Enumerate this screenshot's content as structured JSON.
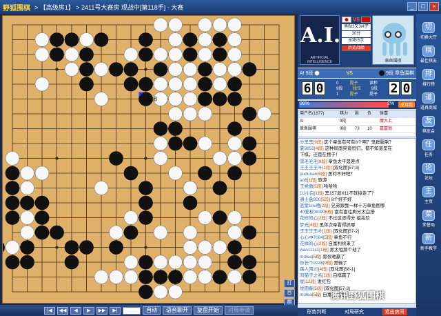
{
  "titlebar": {
    "logo": "野狐围棋",
    "breadcrumb": "> 【高级房1】 > 2411号大赛房 观战中[第118手] - 大赛",
    "buttons": [
      "_",
      "□",
      "×"
    ]
  },
  "board": {
    "size": 19,
    "last_move_label": "118",
    "last_move": {
      "col": 10,
      "row": 6
    },
    "black": [
      [
        4,
        2
      ],
      [
        5,
        2
      ],
      [
        7,
        2
      ],
      [
        10,
        2
      ],
      [
        13,
        2
      ],
      [
        15,
        2
      ],
      [
        4,
        3
      ],
      [
        6,
        3
      ],
      [
        10,
        3
      ],
      [
        13,
        3
      ],
      [
        15,
        3
      ],
      [
        6,
        4
      ],
      [
        8,
        4
      ],
      [
        9,
        4
      ],
      [
        11,
        4
      ],
      [
        14,
        4
      ],
      [
        17,
        4
      ],
      [
        6,
        5
      ],
      [
        9,
        5
      ],
      [
        10,
        5
      ],
      [
        14,
        5
      ],
      [
        16,
        5
      ],
      [
        10,
        6
      ],
      [
        14,
        6
      ],
      [
        15,
        6
      ],
      [
        16,
        6
      ],
      [
        17,
        7
      ],
      [
        11,
        8
      ],
      [
        12,
        8
      ],
      [
        16,
        8
      ],
      [
        12,
        9
      ],
      [
        13,
        9
      ],
      [
        17,
        9
      ],
      [
        8,
        10
      ],
      [
        17,
        10
      ],
      [
        1,
        11
      ],
      [
        9,
        11
      ],
      [
        14,
        11
      ],
      [
        16,
        11
      ],
      [
        1,
        12
      ],
      [
        10,
        12
      ],
      [
        13,
        12
      ],
      [
        15,
        12
      ],
      [
        1,
        13
      ],
      [
        2,
        13
      ],
      [
        3,
        13
      ],
      [
        10,
        13
      ],
      [
        13,
        13
      ],
      [
        1,
        14
      ],
      [
        3,
        14
      ],
      [
        10,
        14
      ],
      [
        15,
        14
      ],
      [
        3,
        15
      ],
      [
        4,
        15
      ],
      [
        9,
        15
      ],
      [
        17,
        15
      ],
      [
        0,
        16
      ],
      [
        2,
        16
      ],
      [
        5,
        16
      ],
      [
        6,
        16
      ],
      [
        8,
        16
      ],
      [
        16,
        16
      ],
      [
        1,
        17
      ],
      [
        2,
        17
      ],
      [
        5,
        17
      ],
      [
        10,
        17
      ],
      [
        16,
        17
      ],
      [
        17,
        17
      ],
      [
        10,
        18
      ],
      [
        11,
        18
      ],
      [
        12,
        18
      ],
      [
        15,
        18
      ],
      [
        17,
        18
      ],
      [
        10,
        19
      ]
    ],
    "white": [
      [
        11,
        1
      ],
      [
        12,
        1
      ],
      [
        14,
        1
      ],
      [
        15,
        1
      ],
      [
        16,
        1
      ],
      [
        3,
        2
      ],
      [
        6,
        2
      ],
      [
        12,
        2
      ],
      [
        14,
        2
      ],
      [
        16,
        2
      ],
      [
        3,
        3
      ],
      [
        5,
        3
      ],
      [
        9,
        3
      ],
      [
        11,
        3
      ],
      [
        12,
        3
      ],
      [
        14,
        3
      ],
      [
        16,
        3
      ],
      [
        5,
        4
      ],
      [
        7,
        4
      ],
      [
        12,
        4
      ],
      [
        13,
        4
      ],
      [
        15,
        4
      ],
      [
        16,
        4
      ],
      [
        3,
        5
      ],
      [
        11,
        5
      ],
      [
        12,
        5
      ],
      [
        13,
        5
      ],
      [
        15,
        5
      ],
      [
        7,
        6
      ],
      [
        11,
        6
      ],
      [
        12,
        6
      ],
      [
        13,
        6
      ],
      [
        12,
        7
      ],
      [
        13,
        7
      ],
      [
        14,
        7
      ],
      [
        18,
        7
      ],
      [
        11,
        9
      ],
      [
        14,
        9
      ],
      [
        16,
        9
      ],
      [
        1,
        10
      ],
      [
        11,
        10
      ],
      [
        15,
        10
      ],
      [
        16,
        10
      ],
      [
        2,
        11
      ],
      [
        3,
        11
      ],
      [
        12,
        11
      ],
      [
        13,
        12
      ],
      [
        7,
        12
      ],
      [
        2,
        12
      ],
      [
        2,
        14
      ],
      [
        2,
        15
      ],
      [
        8,
        15
      ],
      [
        9,
        14
      ],
      [
        14,
        14
      ],
      [
        16,
        14
      ],
      [
        11,
        15
      ],
      [
        13,
        15
      ],
      [
        16,
        15
      ],
      [
        1,
        16
      ],
      [
        13,
        16
      ],
      [
        14,
        16
      ],
      [
        15,
        16
      ],
      [
        14,
        17
      ],
      [
        7,
        18
      ],
      [
        8,
        18
      ],
      [
        9,
        18
      ],
      [
        9,
        17
      ],
      [
        11,
        17
      ],
      [
        12,
        17
      ],
      [
        13,
        17
      ],
      [
        14,
        18
      ],
      [
        13,
        18
      ],
      [
        16,
        18
      ],
      [
        11,
        19
      ],
      [
        12,
        19
      ]
    ]
  },
  "bottombar": {
    "nav": [
      "|◀",
      "◀◀",
      "◀",
      "▶",
      "▶▶",
      "▶|"
    ],
    "buttons": [
      "自动",
      "语音聊开",
      "复盘开始",
      "对局申请"
    ]
  },
  "side_mini": [
    "打",
    "目",
    "棋"
  ],
  "players": {
    "left_logo": "A.I.",
    "left_logo_sub": "ARTIFICIAL INTELLIGENCE",
    "vs": "VS",
    "rule_lines": [
      "黑贴3又3/4子",
      "30分",
      "60秒5次"
    ],
    "history_button": "历史战绩",
    "right_name": "章鱼围棋"
  },
  "scorebar": {
    "left_name": "AI",
    "left_rank": "9段",
    "vs": "VS",
    "right_rank": "9段",
    "right_name": "章鱼围棋"
  },
  "scores": {
    "left_digits": [
      "6",
      "0"
    ],
    "right_digits": [
      "2",
      "0"
    ],
    "stats": [
      {
        "label": "提子",
        "a": "0",
        "b": "读秒"
      },
      {
        "label": "9段",
        "a": "段位",
        "b": "9段"
      },
      {
        "label": "提子",
        "a": "提子",
        "b": "1"
      }
    ]
  },
  "winrate": {
    "left_pct": "98%",
    "right_pct": "2%",
    "hint_label": "支持我"
  },
  "users": {
    "header": [
      "用户名(1877)",
      "棋力",
      "胜",
      "负",
      "财富"
    ],
    "rows": [
      {
        "name": "AI",
        "rank": "9段",
        "win": "",
        "loss": "",
        "wealth": "魔大上"
      },
      {
        "name": "章鱼围棋",
        "rank": "9段",
        "win": "73",
        "loss": "10",
        "wealth": "嘉富翁"
      }
    ]
  },
  "chat": [
    {
      "who": "分黑黑",
      "lv": "[9段]",
      "txt": "这个章鱼有可有8个啊？鬼群疆制？"
    },
    {
      "who": "夏9852",
      "lv": "[4段]",
      "txt": "这种局面突竟恒们，都不知道是在"
    },
    {
      "who": "",
      "lv": "",
      "txt": "下棋，还是在摆子！"
    },
    {
      "who": "雪毛毛毛",
      "lv": "[9段]",
      "txt": "章鱼太平是差点"
    },
    {
      "who": "王王王王叶",
      "lv": "[1段]",
      "txt": "[双化图]57-3]"
    },
    {
      "who": "pudunan",
      "lv": "[8段]",
      "txt": "黑的不好吧？"
    },
    {
      "who": "ao6",
      "lv": "[1段]",
      "txt": "旅游"
    },
    {
      "who": "王党傲",
      "lv": "[5段]",
      "txt": "哈哈哈"
    },
    {
      "who": "DJ小白",
      "lv": "[1段]",
      "txt": "黑157退X11不就接走了？"
    },
    {
      "who": "通士盒800",
      "lv": "[5段]",
      "txt": "8个好不好"
    },
    {
      "who": "蓝紫1ov嘻",
      "lv": "[2段]",
      "txt": "兄弟跟我一样十万章鱼图哪"
    },
    {
      "who": "40爱校3838",
      "lv": "[6段]",
      "txt": "富有富往刷分太白搭"
    },
    {
      "who": "花样的心",
      "lv": "[2段]",
      "txt": "不过这还得分 组兆险"
    },
    {
      "who": "梦光",
      "lv": "[4段]",
      "txt": "黑体次章看得抓哪"
    },
    {
      "who": "王王王王叶",
      "lv": "[1段]",
      "txt": "[双化图]57-2]"
    },
    {
      "who": "心心中7084",
      "lv": "[5段]",
      "txt": "章鱼不行"
    },
    {
      "who": "花样的心",
      "lv": "[2段]",
      "txt": "自富利续来了"
    },
    {
      "who": "wan11111",
      "lv": "[1段]",
      "txt": "黑太怕那个劫了"
    },
    {
      "who": "molea",
      "lv": "[5段]",
      "txt": "黑很难赢了"
    },
    {
      "who": "你长个2248",
      "lv": "[9段]",
      "txt": "黑输了"
    },
    {
      "who": "路人丙20",
      "lv": "[4段]",
      "txt": "[双化图]58-1]"
    },
    {
      "who": "同猫子之名",
      "lv": "[1段]",
      "txt": "白棋赢了"
    },
    {
      "who": "星",
      "lv": "[12段]",
      "txt": "发红包"
    },
    {
      "who": "觉圆春",
      "lv": "[5段]",
      "txt": "[双化图]57-3]"
    },
    {
      "who": "molea",
      "lv": "[5段]",
      "txt": "自富接着看"
    }
  ],
  "tabs": [
    "形势判断",
    "对局研究",
    "退出房间"
  ],
  "sidebar": [
    {
      "icon": "切",
      "label": "切换大厅"
    },
    {
      "icon": "棋",
      "label": "最佳棋友"
    },
    {
      "icon": "排",
      "label": "排行榜"
    },
    {
      "icon": "道",
      "label": "道具商城"
    },
    {
      "icon": "友",
      "label": "棋友会"
    },
    {
      "icon": "任",
      "label": "任务"
    },
    {
      "icon": "论",
      "label": "论坛"
    },
    {
      "icon": "主",
      "label": "主页"
    },
    {
      "icon": "荣",
      "label": "荣誉局"
    },
    {
      "icon": "新",
      "label": "新手教学"
    }
  ],
  "watermark": "腾讯野狐围棋",
  "colors": {
    "board": "#dfb06a",
    "accent": "#d8402a",
    "panel": "#1e3f78"
  }
}
